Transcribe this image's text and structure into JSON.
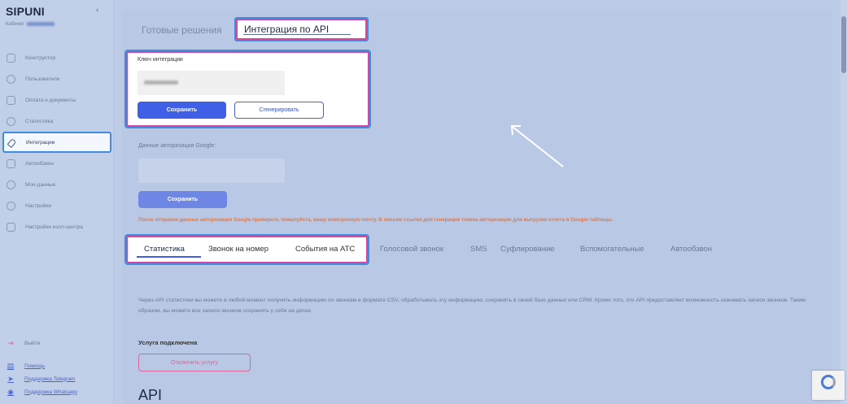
{
  "sidebar": {
    "logo": "SIPUNI",
    "collapse": "‹",
    "cabinet_label": "Кабинет",
    "items": [
      {
        "label": "Конструктор",
        "icon": "cube-icon"
      },
      {
        "label": "Пользователи",
        "icon": "users-icon"
      },
      {
        "label": "Оплата и документы",
        "icon": "wallet-icon"
      },
      {
        "label": "Статистика",
        "icon": "pie-chart-icon"
      },
      {
        "label": "Интеграции",
        "icon": "rocket-icon",
        "active": true
      },
      {
        "label": "Автообзвон",
        "icon": "phone-list-icon"
      },
      {
        "label": "Мои данные",
        "icon": "user-icon"
      },
      {
        "label": "Настройки",
        "icon": "gear-icon"
      },
      {
        "label": "Настройки колл-центра",
        "icon": "sliders-icon"
      }
    ],
    "logout": "Выйти",
    "help": "Помощь",
    "support_telegram": "Поддержка Telegram",
    "support_whatsapp": "Поддержка Whatsapp"
  },
  "header": {
    "tab_ready": "Готовые решения",
    "tab_api": "Интеграция по API"
  },
  "key_panel": {
    "label": "Ключ интеграции",
    "save": "Сохранить",
    "generate": "Сгенерировать"
  },
  "google": {
    "label": "Данные авторизации Google:",
    "save": "Сохранить",
    "warning": "После отправки данных авторизации Google проверьте, пожалуйста, вашу электронную почту. В письме ссылка для генерации токена авторизации для выгрузки отчета в Google-таблицы."
  },
  "tabs": [
    "Статистика",
    "Звонок на номер",
    "События на АТС",
    "Голосовой звонок",
    "SMS",
    "Суфлирование",
    "Вспомогательные",
    "Автообзвон"
  ],
  "description": "Через API статистики вы можете в любой момент получить информацию по звонкам в формате CSV, обработывать эту информацию, сохранять в своей базе данных или CRM. Кроме того, это API предоставляет возможность скачивать записи звонков. Таким образом, вы можете все записи звонков сохранять у себя на диске.",
  "service": {
    "label": "Услуга подключена",
    "disconnect": "Отключить услугу"
  },
  "api_title": "API",
  "colors": {
    "accent": "#3f5fe6",
    "highlight_blue": "#3f8de0",
    "highlight_pink": "#d4479a",
    "warning": "#e07a4a"
  }
}
